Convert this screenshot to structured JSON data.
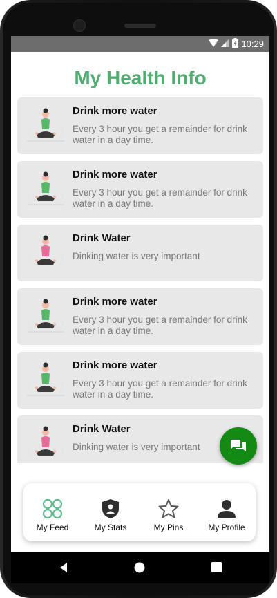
{
  "status_bar": {
    "time": "10:29",
    "wifi_icon": "wifi-icon",
    "signal_icon": "signal-icon",
    "battery_icon": "battery-charging-icon"
  },
  "page": {
    "title": "My Health Info",
    "title_color": "#4fae6f"
  },
  "feed": [
    {
      "title": "Drink more water",
      "description": "Every 3 hour you get a remainder for drink water in a day time."
    },
    {
      "title": "Drink more water",
      "description": "Every 3 hour you get a remainder for drink water in a day time."
    },
    {
      "title": "Drink Water",
      "description": "Dinking water is very important"
    },
    {
      "title": "Drink more water",
      "description": "Every 3 hour you get a remainder for drink water in a day time."
    },
    {
      "title": "Drink more water",
      "description": "Every 3 hour you get a remainder for drink water in a day time."
    },
    {
      "title": "Drink Water",
      "description": "Dinking water is very important"
    }
  ],
  "fab": {
    "icon": "chat-icon",
    "color": "#138a13"
  },
  "bottom_nav": [
    {
      "label": "My Feed",
      "icon": "feed-icon"
    },
    {
      "label": "My Stats",
      "icon": "shield-user-icon"
    },
    {
      "label": "My Pins",
      "icon": "star-icon"
    },
    {
      "label": "My Profile",
      "icon": "person-icon"
    }
  ],
  "system_nav": {
    "back_icon": "back-icon",
    "home_icon": "home-icon",
    "recents_icon": "recents-icon"
  }
}
